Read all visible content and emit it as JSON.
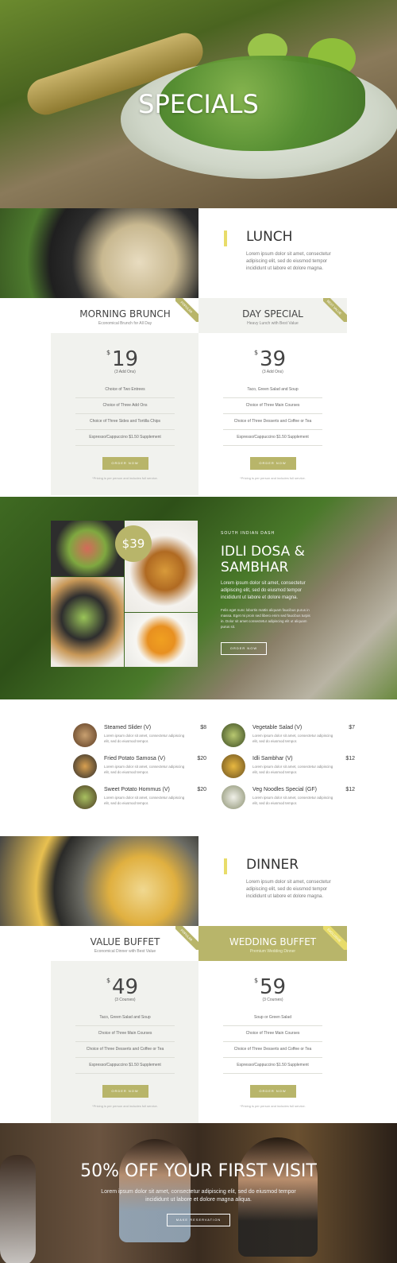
{
  "hero": {
    "title": "SPECIALS"
  },
  "lunch": {
    "heading": "LUNCH",
    "text": "Lorem ipsum dolor sit amet, consectetur adipiscing elit, sed do eiusmod tempor incididunt ut labore et dolore magna.",
    "plans": [
      {
        "title": "MORNING BRUNCH",
        "subtitle": "Economical Brunch for All Day",
        "ribbon": "POPULAR",
        "currency": "$",
        "price": "19",
        "price_note": "(3 Add Ons)",
        "items": [
          "Choice of Two Entrees",
          "Choice of Three Add Ons",
          "Choice of Three Sides and Tortilla Chips",
          "Espresso/Cappuccino $1.50 Supplement"
        ],
        "button": "ORDER NOW",
        "note": "*Pricing is per person and includes full service."
      },
      {
        "title": "DAY SPECIAL",
        "subtitle": "Heavy Lunch with Best Value",
        "ribbon": "BEST VALUE",
        "currency": "$",
        "price": "39",
        "price_note": "(3 Add Ons)",
        "items": [
          "Taco, Green Salad and Soup",
          "Choice of Three Main Courses",
          "Choice of Three Desserts and Coffee or Tea",
          "Espresso/Cappuccino $1.50 Supplement"
        ],
        "button": "ORDER NOW",
        "note": "*Pricing is per person and includes full service."
      }
    ]
  },
  "feature": {
    "price": "$39",
    "kicker": "SOUTH INDIAN DASH",
    "title": "IDLI DOSA & SAMBHAR",
    "text1": "Lorem ipsum dolor sit amet, consectetur adipiscing elit, sed do eiusmod tempor incididunt ut labore et dolore magna.",
    "text2": "Felis eget nunc lobortis mattis aliquam faucibus purus in massa. Eget mi proin sed libero enim sed faucibus turpis in. Dolor sit amet consectetur adipiscing elit ut aliquam purus sit.",
    "button": "ORDER NOW"
  },
  "menu": [
    {
      "name": "Steamed Slider (V)",
      "price": "$8",
      "desc": "Lorem ipsum dolor sit amet, consectetur adipiscing elit, sed do eiusmod tempor."
    },
    {
      "name": "Vegetable Salad (V)",
      "price": "$7",
      "desc": "Lorem ipsum dolor sit amet, consectetur adipiscing elit, sed do eiusmod tempor."
    },
    {
      "name": "Fried Potato Samosa (V)",
      "price": "$20",
      "desc": "Lorem ipsum dolor sit amet, consectetur adipiscing elit, sed do eiusmod tempor."
    },
    {
      "name": "Idli Sambhar (V)",
      "price": "$12",
      "desc": "Lorem ipsum dolor sit amet, consectetur adipiscing elit, sed do eiusmod tempor."
    },
    {
      "name": "Sweet Potato Hommus (V)",
      "price": "$20",
      "desc": "Lorem ipsum dolor sit amet, consectetur adipiscing elit, sed do eiusmod tempor."
    },
    {
      "name": "Veg Noodles Special (GF)",
      "price": "$12",
      "desc": "Lorem ipsum dolor sit amet, consectetur adipiscing elit, sed do eiusmod tempor."
    }
  ],
  "dinner": {
    "heading": "DINNER",
    "text": "Lorem ipsum dolor sit amet, consectetur adipiscing elit, sed do eiusmod tempor incididunt ut labore et dolore magna.",
    "plans": [
      {
        "title": "VALUE BUFFET",
        "subtitle": "Economical Dinner with Best Value",
        "ribbon": "POPULAR",
        "currency": "$",
        "price": "49",
        "price_note": "(3 Courses)",
        "items": [
          "Taco, Green Salad and Soup",
          "Choice of Three Main Courses",
          "Choice of Three Desserts and Coffee or Tea",
          "Espresso/Cappuccino $1.50 Supplement"
        ],
        "button": "ORDER NOW",
        "note": "*Pricing is per person and includes full service."
      },
      {
        "title": "WEDDING BUFFET",
        "subtitle": "Premium Wedding Dinner",
        "ribbon": "EXCLUSIVE",
        "currency": "$",
        "price": "59",
        "price_note": "(3 Courses)",
        "items": [
          "Soup or Green Salad",
          "Choice of Three Main Courses",
          "Choice of Three Desserts and Coffee or Tea",
          "Espresso/Cappuccino $1.50 Supplement"
        ],
        "button": "ORDER NOW",
        "note": "*Pricing is per person and includes full service."
      }
    ]
  },
  "promo": {
    "title": "50% OFF YOUR FIRST VISIT",
    "text": "Lorem ipsum dolor sit amet, consectetur adipiscing elit, sed do eiusmod tempor incididunt ut labore et dolore magna aliqua.",
    "button": "MAKE RESERVATION"
  },
  "colors": {
    "accent": "#b8b56a",
    "accent_bar": "#e8dc6a",
    "plan_bg": "#f1f2ee"
  }
}
